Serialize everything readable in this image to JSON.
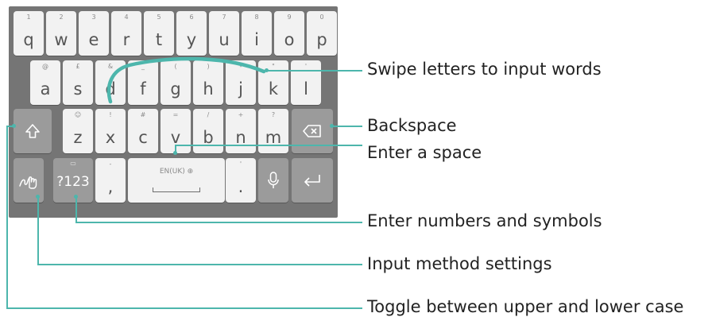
{
  "keyboard": {
    "row1": [
      {
        "hint": "1",
        "label": "q"
      },
      {
        "hint": "2",
        "label": "w"
      },
      {
        "hint": "3",
        "label": "e"
      },
      {
        "hint": "4",
        "label": "r"
      },
      {
        "hint": "5",
        "label": "t"
      },
      {
        "hint": "6",
        "label": "y"
      },
      {
        "hint": "7",
        "label": "u"
      },
      {
        "hint": "8",
        "label": "i"
      },
      {
        "hint": "9",
        "label": "o"
      },
      {
        "hint": "0",
        "label": "p"
      }
    ],
    "row2": [
      {
        "hint": "@",
        "label": "a"
      },
      {
        "hint": "£",
        "label": "s"
      },
      {
        "hint": "&",
        "label": "d"
      },
      {
        "hint": "_",
        "label": "f"
      },
      {
        "hint": "(",
        "label": "g"
      },
      {
        "hint": ")",
        "label": "h"
      },
      {
        "hint": "-",
        "label": "j"
      },
      {
        "hint": "\"",
        "label": "k"
      },
      {
        "hint": "'",
        "label": "l"
      }
    ],
    "row3": [
      {
        "hint": "☺",
        "label": "z"
      },
      {
        "hint": "!",
        "label": "x"
      },
      {
        "hint": "#",
        "label": "c"
      },
      {
        "hint": "=",
        "label": "v"
      },
      {
        "hint": "/",
        "label": "b"
      },
      {
        "hint": "+",
        "label": "n"
      },
      {
        "hint": "?",
        "label": "m"
      }
    ],
    "row4": {
      "symbols_label": "?123",
      "comma_hint": "-",
      "comma_label": ",",
      "space_hint": "EN(UK)",
      "period_hint": "'",
      "period_label": "."
    },
    "icons": {
      "shift": "shift-arrow-icon",
      "backspace": "backspace-icon",
      "settings": "handwriting-hand-icon",
      "mic": "microphone-icon",
      "enter": "enter-arrow-icon"
    }
  },
  "callouts": {
    "swipe": "Swipe letters to input words",
    "backspace": "Backspace",
    "space": "Enter a space",
    "numbers": "Enter numbers and symbols",
    "settings": "Input method settings",
    "toggle_case": "Toggle between upper and lower case"
  },
  "colors": {
    "accent": "#4db6ac",
    "keyboard_bg": "#757575",
    "key_bg": "#f2f2f2",
    "func_key_bg": "#9b9b9b"
  }
}
